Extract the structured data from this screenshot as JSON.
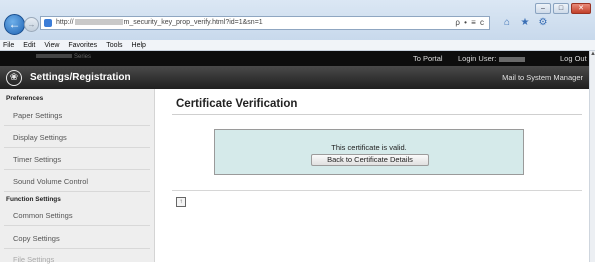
{
  "browser": {
    "url_prefix": "http://",
    "url_mid": "m_security_key_prop_verify.html?id=1&sn=1",
    "url_tools": "ρ • ≡ c",
    "window_controls": [
      "–",
      "□",
      "✕"
    ],
    "back_icon": "←",
    "forward_icon": "→",
    "toolbar_icons": [
      "⌂",
      "★",
      "⚙"
    ]
  },
  "menu": [
    "File",
    "Edit",
    "View",
    "Favorites",
    "Tools",
    "Help"
  ],
  "app": {
    "device_series": "Series",
    "title": "Settings/Registration",
    "logo_icon": "❀",
    "to_portal": "To Portal",
    "login_user_label": "Login User:",
    "log_out": "Log Out",
    "mail_link": "Mail to System Manager"
  },
  "sidebar": {
    "sections": [
      {
        "heading": "Preferences",
        "items": [
          "Paper Settings",
          "Display Settings",
          "Timer Settings",
          "Sound Volume Control"
        ]
      },
      {
        "heading": "Function Settings",
        "items": [
          "Common Settings",
          "Copy Settings",
          "File Settings"
        ]
      }
    ]
  },
  "main": {
    "title": "Certificate Verification",
    "result_message": "This certificate is valid.",
    "back_button": "Back to Certificate Details",
    "top_icon": "↑"
  }
}
